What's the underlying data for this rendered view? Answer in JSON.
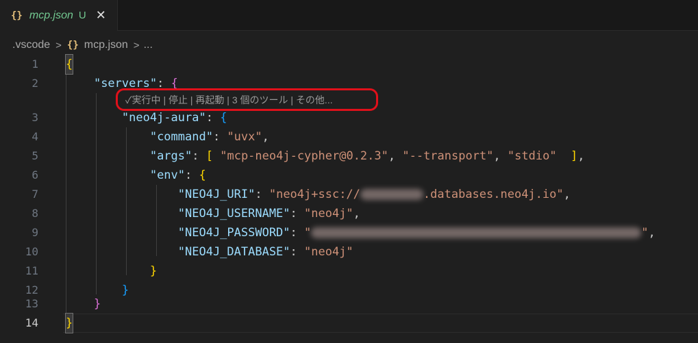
{
  "tab": {
    "icon": "{}",
    "title": "mcp.json",
    "status": "U",
    "close": "✕"
  },
  "breadcrumb": {
    "folder": ".vscode",
    "separator": ">",
    "file_icon": "{}",
    "file": "mcp.json",
    "more": "..."
  },
  "codelens": {
    "running": "✓実行中",
    "stop": "停止",
    "restart": "再起動",
    "tools": "3 個のツール",
    "more": "その他...",
    "divider": " | "
  },
  "editor": {
    "line_numbers": [
      "1",
      "2",
      "3",
      "4",
      "5",
      "6",
      "7",
      "8",
      "9",
      "10",
      "11",
      "12",
      "13",
      "14"
    ],
    "active_line": "14",
    "keys": {
      "servers": "\"servers\"",
      "server_name": "\"neo4j-aura\"",
      "command": "\"command\"",
      "args": "\"args\"",
      "env": "\"env\"",
      "uri": "\"NEO4J_URI\"",
      "username": "\"NEO4J_USERNAME\"",
      "password": "\"NEO4J_PASSWORD\"",
      "database": "\"NEO4J_DATABASE\""
    },
    "values": {
      "command": "\"uvx\"",
      "arg1": "\"mcp-neo4j-cypher@0.2.3\"",
      "arg2": "\"--transport\"",
      "arg3": "\"stdio\"",
      "uri_prefix": "\"neo4j+ssc://",
      "uri_suffix": ".databases.neo4j.io\"",
      "username": "\"neo4j\"",
      "password_open": "\"",
      "password_close": "\"",
      "database": "\"neo4j\""
    }
  }
}
